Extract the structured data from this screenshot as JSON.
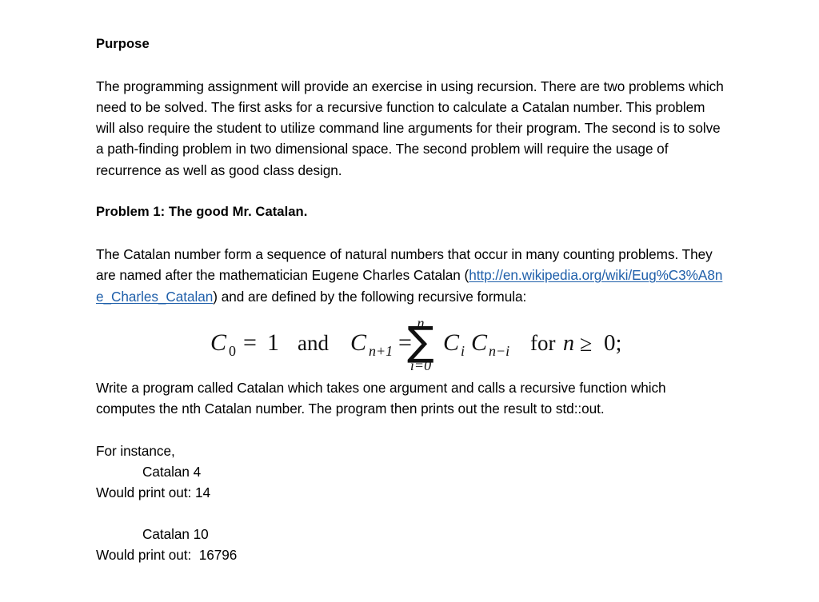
{
  "document": {
    "heading_purpose": "Purpose",
    "paragraph_purpose": "The programming assignment will provide an exercise in using recursion.  There are two problems which need to be solved.  The first asks for a recursive function to calculate a Catalan number.  This problem will also require the student to utilize command line arguments for their program.  The second is to solve a path-finding problem in two dimensional space.  The second problem will require the usage of recurrence as well as good class design.",
    "heading_problem1": "Problem 1:  The good Mr. Catalan.",
    "paragraph_catalan_intro_before_link": "The Catalan number form a sequence of natural numbers that occur in many counting problems.  They are named after the mathematician Eugene Charles Catalan (",
    "link_text": "http://en.wikipedia.org/wiki/Eug%C3%A8ne_Charles_Catalan",
    "link_color": "#1f5faa",
    "paragraph_catalan_intro_after_link": ") and are defined by the following recursive formula:",
    "formula": {
      "c0_symbol": "C",
      "c0_sub": "0",
      "equals": "=",
      "one": "1",
      "and": "and",
      "cn1_symbol": "C",
      "cn1_sub": "n+1",
      "equals2": "=",
      "sum_glyph": "∑",
      "sum_upper": "n",
      "sum_lower": "i=0",
      "term1_symbol": "C",
      "term1_sub": "i",
      "term2_symbol": "C",
      "term2_sub": "n−i",
      "condition": "for n ≥ 0;",
      "plain_text": "C0 = 1   and   Cn+1 = ∑ (i=0 to n) Ci Cn−i   for n ≥ 0;"
    },
    "paragraph_write_program": "Write a program called Catalan which takes one argument and calls a recursive function which computes the nth Catalan number.  The program then prints out the result to std::out.",
    "for_instance_label": "For instance,",
    "example1_command": "Catalan 4",
    "example1_output": "Would print out: 14",
    "example2_command": "Catalan 10",
    "example2_output": "Would print out:  16796"
  }
}
